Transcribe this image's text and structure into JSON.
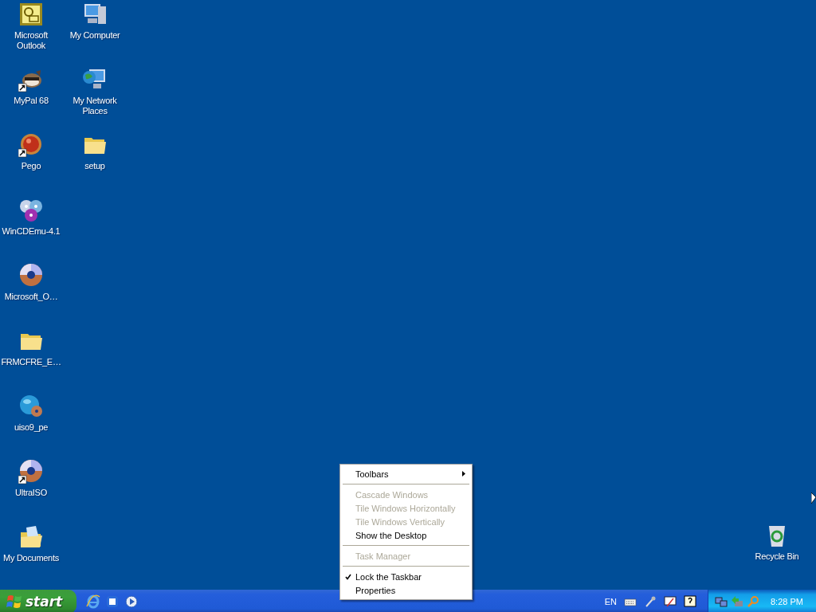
{
  "desktop": {
    "columns": [
      [
        {
          "label": "Microsoft Outlook",
          "kind": "outlook",
          "shortcut": false
        },
        {
          "label": "MyPal 68",
          "kind": "raccoon",
          "shortcut": true
        },
        {
          "label": "Pego",
          "kind": "ball",
          "shortcut": true
        },
        {
          "label": "WinCDEmu-4.1",
          "kind": "discs",
          "shortcut": false
        },
        {
          "label": "Microsoft_O…",
          "kind": "disc",
          "shortcut": false
        },
        {
          "label": "FRMCFRE_E…",
          "kind": "folder",
          "shortcut": false
        },
        {
          "label": "uiso9_pe",
          "kind": "globe",
          "shortcut": false
        },
        {
          "label": "UltraISO",
          "kind": "disc",
          "shortcut": true
        },
        {
          "label": "My Documents",
          "kind": "documents",
          "shortcut": false
        }
      ],
      [
        {
          "label": "My Computer",
          "kind": "computer",
          "shortcut": false
        },
        {
          "label": "My Network Places",
          "kind": "network",
          "shortcut": false
        },
        {
          "label": "setup",
          "kind": "folder",
          "shortcut": false
        }
      ]
    ],
    "recycle_bin": {
      "label": "Recycle Bin"
    }
  },
  "context_menu": {
    "items": [
      {
        "kind": "item",
        "label": "Toolbars",
        "submenu": true,
        "disabled": false,
        "checked": false
      },
      {
        "kind": "separator"
      },
      {
        "kind": "item",
        "label": "Cascade Windows",
        "submenu": false,
        "disabled": true,
        "checked": false
      },
      {
        "kind": "item",
        "label": "Tile Windows Horizontally",
        "submenu": false,
        "disabled": true,
        "checked": false
      },
      {
        "kind": "item",
        "label": "Tile Windows Vertically",
        "submenu": false,
        "disabled": true,
        "checked": false
      },
      {
        "kind": "item",
        "label": "Show the Desktop",
        "submenu": false,
        "disabled": false,
        "checked": false
      },
      {
        "kind": "separator"
      },
      {
        "kind": "item",
        "label": "Task Manager",
        "submenu": false,
        "disabled": true,
        "checked": false
      },
      {
        "kind": "separator"
      },
      {
        "kind": "item",
        "label": "Lock the Taskbar",
        "submenu": false,
        "disabled": false,
        "checked": true
      },
      {
        "kind": "item",
        "label": "Properties",
        "submenu": false,
        "disabled": false,
        "checked": false
      }
    ]
  },
  "taskbar": {
    "start_label": "start",
    "language": "EN",
    "clock": "8:28 PM"
  }
}
